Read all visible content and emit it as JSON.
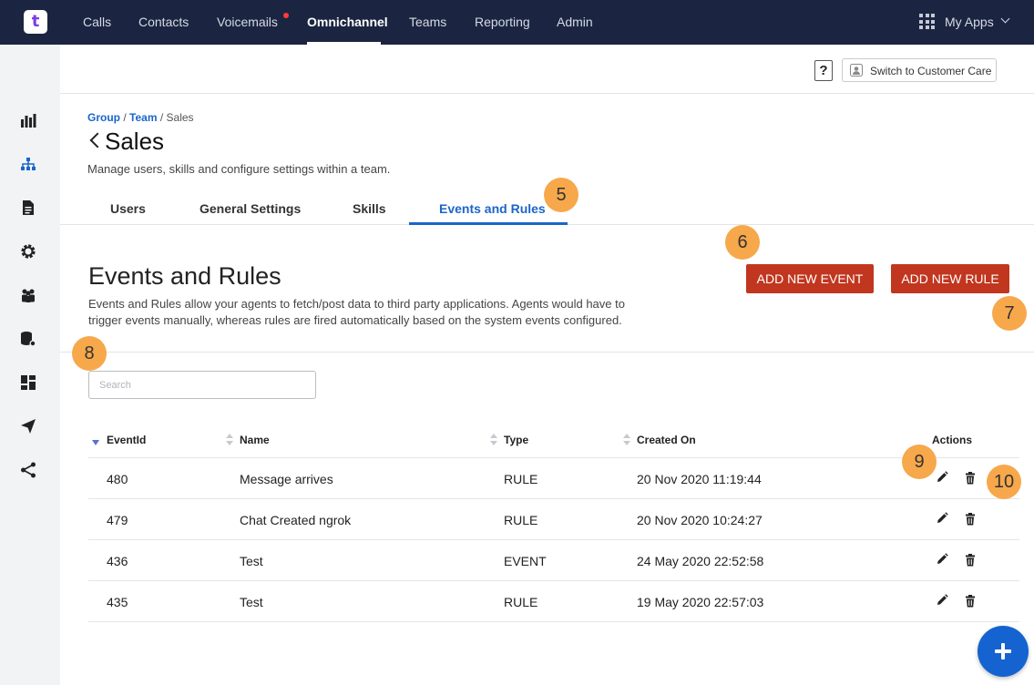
{
  "nav": {
    "logo": "t",
    "items": [
      {
        "label": "Calls"
      },
      {
        "label": "Contacts"
      },
      {
        "label": "Voicemails"
      },
      {
        "label": "Omnichannel"
      },
      {
        "label": "Teams"
      },
      {
        "label": "Reporting"
      },
      {
        "label": "Admin"
      }
    ],
    "active": "Omnichannel",
    "my_apps": "My Apps"
  },
  "sidebar": {
    "icons": [
      "bar-chart-icon",
      "org-chart-icon",
      "document-icon",
      "gear-icon",
      "team-icon",
      "database-settings-icon",
      "dashboard-icon",
      "send-icon",
      "share-icon"
    ],
    "active": "org-chart-icon"
  },
  "header": {
    "help": "?",
    "switch_label": "Switch to Customer Care"
  },
  "breadcrumb": {
    "group": "Group",
    "team": "Team",
    "current": "Sales",
    "sep": "/"
  },
  "page": {
    "title": "Sales",
    "description": "Manage users, skills and configure settings within a team."
  },
  "tabs": [
    {
      "label": "Users"
    },
    {
      "label": "General Settings"
    },
    {
      "label": "Skills"
    },
    {
      "label": "Events and Rules"
    }
  ],
  "active_tab": "Events and Rules",
  "section": {
    "title": "Events and Rules",
    "description": "Events and Rules allow your agents to fetch/post data to third party applications. Agents would have to trigger events manually, whereas rules are fired automatically based on the system events configured.",
    "add_event": "ADD NEW EVENT",
    "add_rule": "ADD NEW RULE"
  },
  "search": {
    "placeholder": "Search",
    "value": ""
  },
  "table": {
    "columns": [
      "EventId",
      "Name",
      "Type",
      "Created On",
      "Actions"
    ],
    "rows": [
      {
        "id": "480",
        "name": "Message arrives",
        "type": "RULE",
        "created": "20 Nov 2020 11:19:44"
      },
      {
        "id": "479",
        "name": "Chat Created ngrok",
        "type": "RULE",
        "created": "20 Nov 2020 10:24:27"
      },
      {
        "id": "436",
        "name": "Test",
        "type": "EVENT",
        "created": "24 May 2020 22:52:58"
      },
      {
        "id": "435",
        "name": "Test",
        "type": "RULE",
        "created": "19 May 2020 22:57:03"
      }
    ]
  },
  "badges": [
    "5",
    "6",
    "7",
    "8",
    "9",
    "10"
  ],
  "colors": {
    "topbar": "#1b2541",
    "accent": "#1a66c9",
    "button_red": "#c1361f",
    "badge": "#f7a84b",
    "fab": "#1463d1"
  }
}
